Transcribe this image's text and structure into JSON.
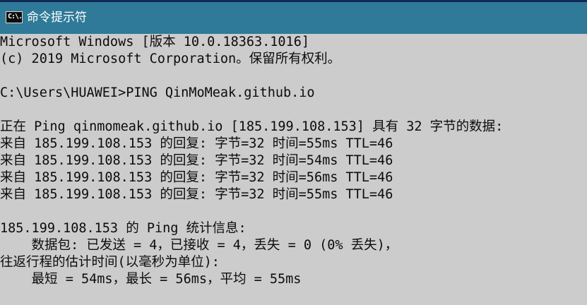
{
  "window": {
    "title": "命令提示符",
    "icon": "cmd-icon",
    "icon_text": "C:\\.",
    "colors": {
      "titlebar": "#2f7a98",
      "console_bg": "#cccccc",
      "console_text": "#0c0c0c"
    }
  },
  "console": {
    "lines": [
      "Microsoft Windows [版本 10.0.18363.1016]",
      "(c) 2019 Microsoft Corporation。保留所有权利。",
      "",
      "C:\\Users\\HUAWEI>PING QinMoMeak.github.io",
      "",
      "正在 Ping qinmomeak.github.io [185.199.108.153] 具有 32 字节的数据:",
      "来自 185.199.108.153 的回复: 字节=32 时间=55ms TTL=46",
      "来自 185.199.108.153 的回复: 字节=32 时间=54ms TTL=46",
      "来自 185.199.108.153 的回复: 字节=32 时间=56ms TTL=46",
      "来自 185.199.108.153 的回复: 字节=32 时间=55ms TTL=46",
      "",
      "185.199.108.153 的 Ping 统计信息:",
      "    数据包: 已发送 = 4，已接收 = 4，丢失 = 0 (0% 丢失)，",
      "往返行程的估计时间(以毫秒为单位):",
      "    最短 = 54ms，最长 = 56ms，平均 = 55ms"
    ]
  }
}
